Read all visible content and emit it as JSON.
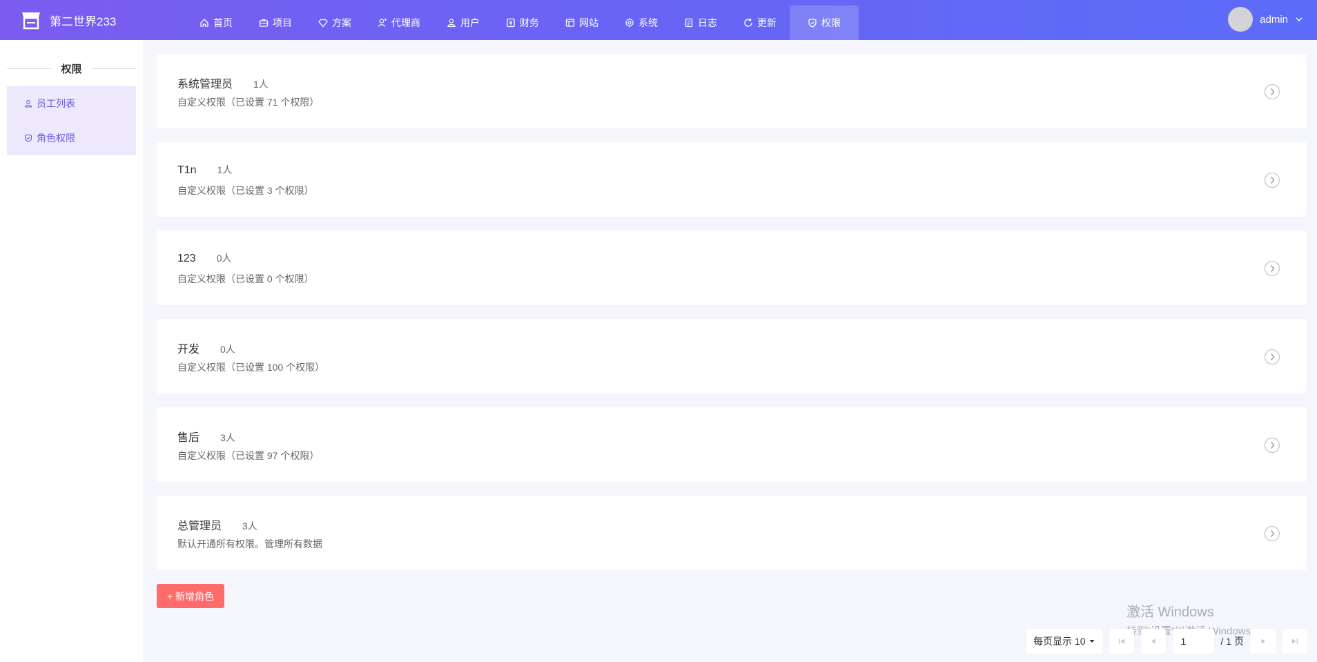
{
  "brand": {
    "name": "第二世界233"
  },
  "nav": [
    {
      "label": "首页",
      "icon": "home-icon"
    },
    {
      "label": "项目",
      "icon": "briefcase-icon"
    },
    {
      "label": "方案",
      "icon": "diamond-icon"
    },
    {
      "label": "代理商",
      "icon": "agent-icon"
    },
    {
      "label": "用户",
      "icon": "user-icon"
    },
    {
      "label": "财务",
      "icon": "finance-icon"
    },
    {
      "label": "网站",
      "icon": "website-icon"
    },
    {
      "label": "系统",
      "icon": "gear-icon"
    },
    {
      "label": "日志",
      "icon": "log-icon"
    },
    {
      "label": "更新",
      "icon": "refresh-icon"
    },
    {
      "label": "权限",
      "icon": "shield-icon",
      "active": true
    }
  ],
  "user": {
    "name": "admin"
  },
  "sidebar": {
    "title": "权限",
    "items": [
      {
        "label": "员工列表",
        "icon": "user-icon"
      },
      {
        "label": "角色权限",
        "icon": "shield-icon"
      }
    ]
  },
  "roles": [
    {
      "name": "系统管理员",
      "count": "1人",
      "desc": "自定义权限（已设置 71 个权限）"
    },
    {
      "name": "T1n",
      "count": "1人",
      "desc": "自定义权限（已设置 3 个权限）"
    },
    {
      "name": "123",
      "count": "0人",
      "desc": "自定义权限（已设置 0 个权限）"
    },
    {
      "name": "开发",
      "count": "0人",
      "desc": "自定义权限（已设置 100 个权限）"
    },
    {
      "name": "售后",
      "count": "3人",
      "desc": "自定义权限（已设置 97 个权限）"
    },
    {
      "name": "总管理员",
      "count": "3人",
      "desc": "默认开通所有权限。管理所有数据"
    }
  ],
  "actions": {
    "add_role": "+ 新增角色"
  },
  "watermark": {
    "line1": "激活 Windows",
    "line2": "转到“设置”以激活 Windows。"
  },
  "pagination": {
    "page_size_label": "每页显示 10",
    "current": "1",
    "total_label": "/ 1 页"
  },
  "colors": {
    "header_start": "#7b5cf0",
    "header_end": "#5c6cf8",
    "accent": "#6c5ce7",
    "add_button": "#ff6b6b"
  }
}
